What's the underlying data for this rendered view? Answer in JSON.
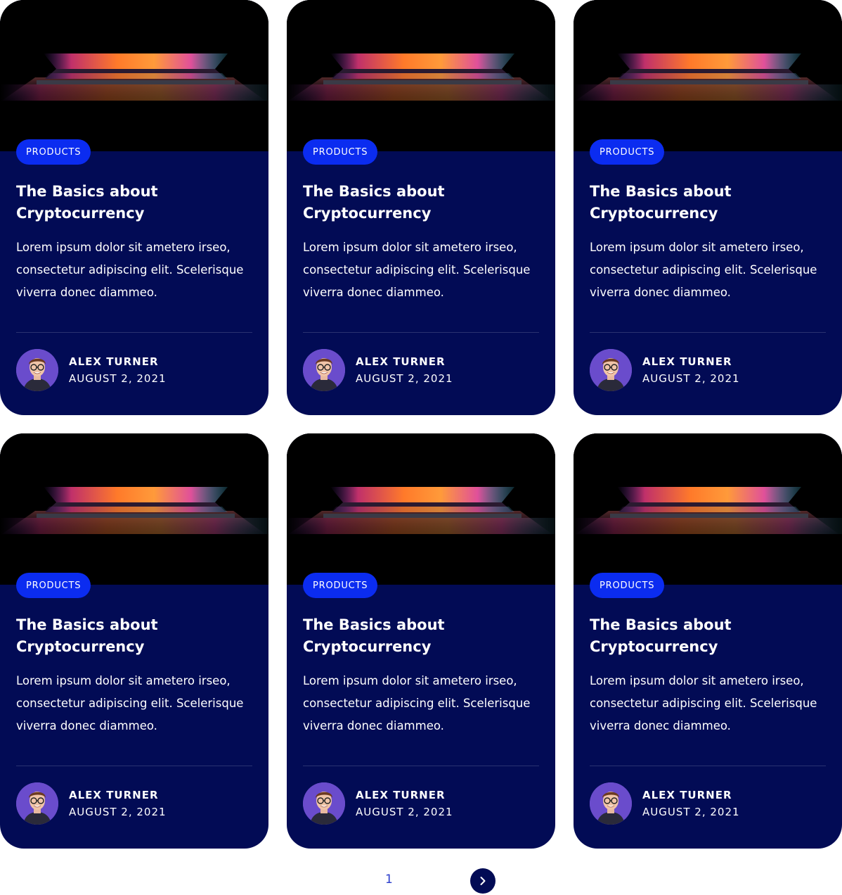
{
  "colors": {
    "card_background": "#020b55",
    "badge_background": "#0b2cf0",
    "pagination_accent": "#2a3ccc"
  },
  "posts": [
    {
      "category": "PRODUCTS",
      "title": "The Basics about Cryptocurrency",
      "excerpt": "Lorem ipsum dolor sit ametero irseo, consectetur adipiscing elit. Scelerisque viverra donec diammeo.",
      "author": "ALEX TURNER",
      "date": "AUGUST 2, 2021",
      "image": "laptop-image",
      "avatar": "author-avatar"
    },
    {
      "category": "PRODUCTS",
      "title": "The Basics about Cryptocurrency",
      "excerpt": "Lorem ipsum dolor sit ametero irseo, consectetur adipiscing elit. Scelerisque viverra donec diammeo.",
      "author": "ALEX TURNER",
      "date": "AUGUST 2, 2021",
      "image": "laptop-image",
      "avatar": "author-avatar"
    },
    {
      "category": "PRODUCTS",
      "title": "The Basics about Cryptocurrency",
      "excerpt": "Lorem ipsum dolor sit ametero irseo, consectetur adipiscing elit. Scelerisque viverra donec diammeo.",
      "author": "ALEX TURNER",
      "date": "AUGUST 2, 2021",
      "image": "laptop-image",
      "avatar": "author-avatar"
    },
    {
      "category": "PRODUCTS",
      "title": "The Basics about Cryptocurrency",
      "excerpt": "Lorem ipsum dolor sit ametero irseo, consectetur adipiscing elit. Scelerisque viverra donec diammeo.",
      "author": "ALEX TURNER",
      "date": "AUGUST 2, 2021",
      "image": "laptop-image",
      "avatar": "author-avatar"
    },
    {
      "category": "PRODUCTS",
      "title": "The Basics about Cryptocurrency",
      "excerpt": "Lorem ipsum dolor sit ametero irseo, consectetur adipiscing elit. Scelerisque viverra donec diammeo.",
      "author": "ALEX TURNER",
      "date": "AUGUST 2, 2021",
      "image": "laptop-image",
      "avatar": "author-avatar"
    },
    {
      "category": "PRODUCTS",
      "title": "The Basics about Cryptocurrency",
      "excerpt": "Lorem ipsum dolor sit ametero irseo, consectetur adipiscing elit. Scelerisque viverra donec diammeo.",
      "author": "ALEX TURNER",
      "date": "AUGUST 2, 2021",
      "image": "laptop-image",
      "avatar": "author-avatar"
    }
  ],
  "pagination": {
    "current_page": "1",
    "next_icon": "chevron-right-icon"
  }
}
